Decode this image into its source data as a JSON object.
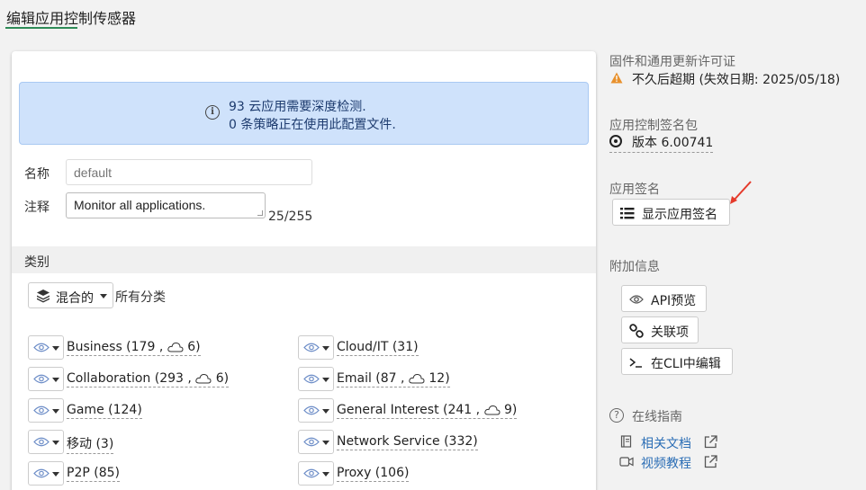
{
  "page": {
    "title": "编辑应用控制传感器"
  },
  "info": {
    "line1": "93 云应用需要深度检测.",
    "line2": "0 条策略正在使用此配置文件."
  },
  "form": {
    "name_label": "名称",
    "name_placeholder": "default",
    "comment_label": "注释",
    "comment_value": "Monitor all applications.",
    "char_count": "25/255"
  },
  "categories": {
    "header": "类别",
    "mix_button": "混合的",
    "all_label": "所有分类",
    "left": [
      {
        "name": "Business",
        "text": "Business (179 ,",
        "cloud": "6)"
      },
      {
        "name": "Collaboration",
        "text": "Collaboration (293 ,",
        "cloud": "6)"
      },
      {
        "name": "Game",
        "text": "Game (124)",
        "cloud": ""
      },
      {
        "name": "移动",
        "text": "移动 (3)",
        "cloud": ""
      },
      {
        "name": "P2P",
        "text": "P2P (85)",
        "cloud": ""
      }
    ],
    "right": [
      {
        "name": "Cloud/IT",
        "text": "Cloud/IT (31)",
        "cloud": ""
      },
      {
        "name": "Email",
        "text": "Email (87 ,",
        "cloud": "12)"
      },
      {
        "name": "General Interest",
        "text": "General Interest (241 ,",
        "cloud": "9)"
      },
      {
        "name": "Network Service",
        "text": "Network Service (332)",
        "cloud": ""
      },
      {
        "name": "Proxy",
        "text": "Proxy (106)",
        "cloud": ""
      }
    ]
  },
  "sidebar": {
    "license_title": "固件和通用更新许可证",
    "license_status": "不久后超期 (失效日期: 2025/05/18)",
    "sigpack_title": "应用控制签名包",
    "sigpack_version": "版本 6.00741",
    "appsig_title": "应用签名",
    "show_sig_button": "显示应用签名",
    "extra_title": "附加信息",
    "api_preview": "API预览",
    "references": "关联项",
    "edit_cli": "在CLI中编辑",
    "online_guide": "在线指南",
    "related_docs": "相关文档",
    "video_tutorial": "视频教程"
  },
  "colors": {
    "info_bg": "#cfe2fb",
    "accent_green": "#2e8b57",
    "link_blue": "#2a6db5",
    "warning_orange": "#e8912d",
    "arrow_red": "#e53a2b"
  }
}
